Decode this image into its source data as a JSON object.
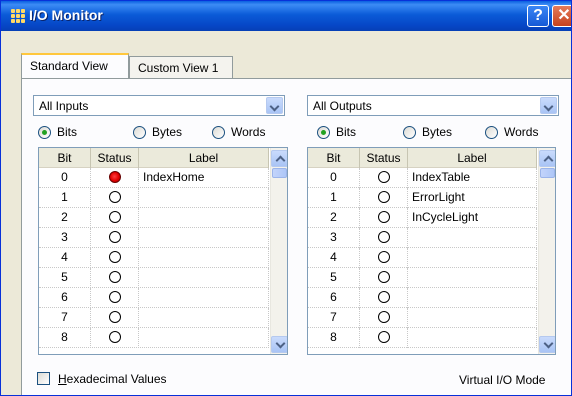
{
  "window": {
    "title": "I/O Monitor",
    "help_label": "?",
    "close_label": "✕"
  },
  "tabs": [
    {
      "label": "Standard View",
      "active": true
    },
    {
      "label": "Custom View 1",
      "active": false
    }
  ],
  "inputs": {
    "dropdown_value": "All Inputs",
    "radios": [
      {
        "label": "Bits",
        "checked": true
      },
      {
        "label": "Bytes",
        "checked": false
      },
      {
        "label": "Words",
        "checked": false
      }
    ],
    "columns": [
      "Bit",
      "Status",
      "Label"
    ],
    "rows": [
      {
        "bit": "0",
        "on": true,
        "label": "IndexHome"
      },
      {
        "bit": "1",
        "on": false,
        "label": ""
      },
      {
        "bit": "2",
        "on": false,
        "label": ""
      },
      {
        "bit": "3",
        "on": false,
        "label": ""
      },
      {
        "bit": "4",
        "on": false,
        "label": ""
      },
      {
        "bit": "5",
        "on": false,
        "label": ""
      },
      {
        "bit": "6",
        "on": false,
        "label": ""
      },
      {
        "bit": "7",
        "on": false,
        "label": ""
      },
      {
        "bit": "8",
        "on": false,
        "label": ""
      }
    ]
  },
  "outputs": {
    "dropdown_value": "All Outputs",
    "radios": [
      {
        "label": "Bits",
        "checked": true
      },
      {
        "label": "Bytes",
        "checked": false
      },
      {
        "label": "Words",
        "checked": false
      }
    ],
    "columns": [
      "Bit",
      "Status",
      "Label"
    ],
    "rows": [
      {
        "bit": "0",
        "on": false,
        "label": "IndexTable"
      },
      {
        "bit": "1",
        "on": false,
        "label": "ErrorLight"
      },
      {
        "bit": "2",
        "on": false,
        "label": "InCycleLight"
      },
      {
        "bit": "3",
        "on": false,
        "label": ""
      },
      {
        "bit": "4",
        "on": false,
        "label": ""
      },
      {
        "bit": "5",
        "on": false,
        "label": ""
      },
      {
        "bit": "6",
        "on": false,
        "label": ""
      },
      {
        "bit": "7",
        "on": false,
        "label": ""
      },
      {
        "bit": "8",
        "on": false,
        "label": ""
      }
    ]
  },
  "footer": {
    "hex_label_first": "H",
    "hex_label_rest": "exadecimal Values",
    "hex_checked": false,
    "mode_text": "Virtual I/O Mode"
  },
  "colors": {
    "titlebar": "#0b5bd8",
    "status_on": "#e00000",
    "radio_checked": "#21a121",
    "tab_highlight": "#ffc73c"
  }
}
